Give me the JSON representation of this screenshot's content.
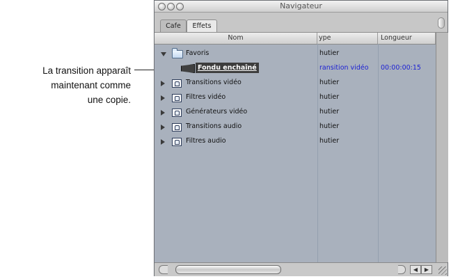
{
  "callout": {
    "lines": [
      "La transition apparaît",
      "maintenant comme",
      "une copie."
    ]
  },
  "window": {
    "title": "Navigateur",
    "tabs": [
      "Cafe",
      "Effets"
    ],
    "active_tab": "Effets",
    "columns": {
      "name": "Nom",
      "type": "ype",
      "length": "Longueur"
    },
    "rows": [
      {
        "name": "Favoris",
        "type": "hutier",
        "length": "",
        "icon": "folder-icon",
        "expanded": true,
        "indent": 0
      },
      {
        "name": "Fondu enchaîné",
        "type": "ransition vidéo",
        "length": "00:00:00:15",
        "icon": "transition-clip-icon",
        "selected": true,
        "indent": 1
      },
      {
        "name": "Transitions vidéo",
        "type": "hutier",
        "length": "",
        "icon": "locked-bin-icon",
        "expanded": false,
        "indent": 0
      },
      {
        "name": "Filtres vidéo",
        "type": "hutier",
        "length": "",
        "icon": "locked-bin-icon",
        "expanded": false,
        "indent": 0
      },
      {
        "name": "Générateurs vidéo",
        "type": "hutier",
        "length": "",
        "icon": "locked-bin-icon",
        "expanded": false,
        "indent": 0
      },
      {
        "name": "Transitions audio",
        "type": "hutier",
        "length": "",
        "icon": "locked-bin-icon",
        "expanded": false,
        "indent": 0
      },
      {
        "name": "Filtres audio",
        "type": "hutier",
        "length": "",
        "icon": "locked-bin-icon",
        "expanded": false,
        "indent": 0
      }
    ]
  },
  "colors": {
    "window_bg": "#a9b1bd",
    "selection_bg": "#3c3c3c",
    "link_blue": "#1b1fd4"
  }
}
